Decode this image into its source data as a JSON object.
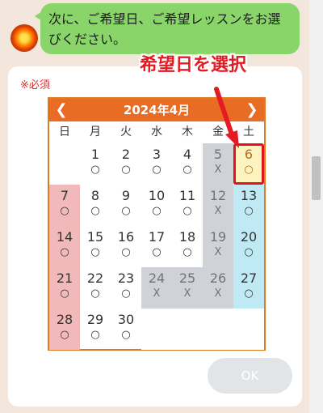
{
  "chat": {
    "avatar_icon": "sun-avatar-icon",
    "message": "次に、ご希望日、ご希望レッスンをお選びください。"
  },
  "form": {
    "required_label": "※必須",
    "ok_label": "OK"
  },
  "calendar": {
    "title": "2024年4月",
    "prev_icon": "chevron-left-icon",
    "next_icon": "chevron-right-icon",
    "weekdays": [
      "日",
      "月",
      "火",
      "水",
      "木",
      "金",
      "土"
    ],
    "weeks": [
      [
        null,
        {
          "d": "1",
          "m": "○"
        },
        {
          "d": "2",
          "m": "○"
        },
        {
          "d": "3",
          "m": "○"
        },
        {
          "d": "4",
          "m": "○"
        },
        {
          "d": "5",
          "m": "X"
        },
        {
          "d": "6",
          "m": "○"
        }
      ],
      [
        {
          "d": "7",
          "m": "○"
        },
        {
          "d": "8",
          "m": "○"
        },
        {
          "d": "9",
          "m": "○"
        },
        {
          "d": "10",
          "m": "○"
        },
        {
          "d": "11",
          "m": "○"
        },
        {
          "d": "12",
          "m": "X"
        },
        {
          "d": "13",
          "m": "○"
        }
      ],
      [
        {
          "d": "14",
          "m": "○"
        },
        {
          "d": "15",
          "m": "○"
        },
        {
          "d": "16",
          "m": "○"
        },
        {
          "d": "17",
          "m": "○"
        },
        {
          "d": "18",
          "m": "○"
        },
        {
          "d": "19",
          "m": "X"
        },
        {
          "d": "20",
          "m": "○"
        }
      ],
      [
        {
          "d": "21",
          "m": "○"
        },
        {
          "d": "22",
          "m": "○"
        },
        {
          "d": "23",
          "m": "○"
        },
        {
          "d": "24",
          "m": "X"
        },
        {
          "d": "25",
          "m": "X"
        },
        {
          "d": "26",
          "m": "X"
        },
        {
          "d": "27",
          "m": "○"
        }
      ],
      [
        {
          "d": "28",
          "m": "○"
        },
        {
          "d": "29",
          "m": "○"
        },
        {
          "d": "30",
          "m": "○"
        },
        null,
        null,
        null,
        null
      ]
    ],
    "selected_day": "6"
  },
  "annotation": {
    "label": "希望日を選択",
    "color": "#e41b23"
  },
  "colors": {
    "header": "#e86c24",
    "sunday": "#f1b9b9",
    "saturday": "#bfeaf5",
    "unavailable": "#cfd3d8",
    "bubble": "#8ad56a"
  }
}
